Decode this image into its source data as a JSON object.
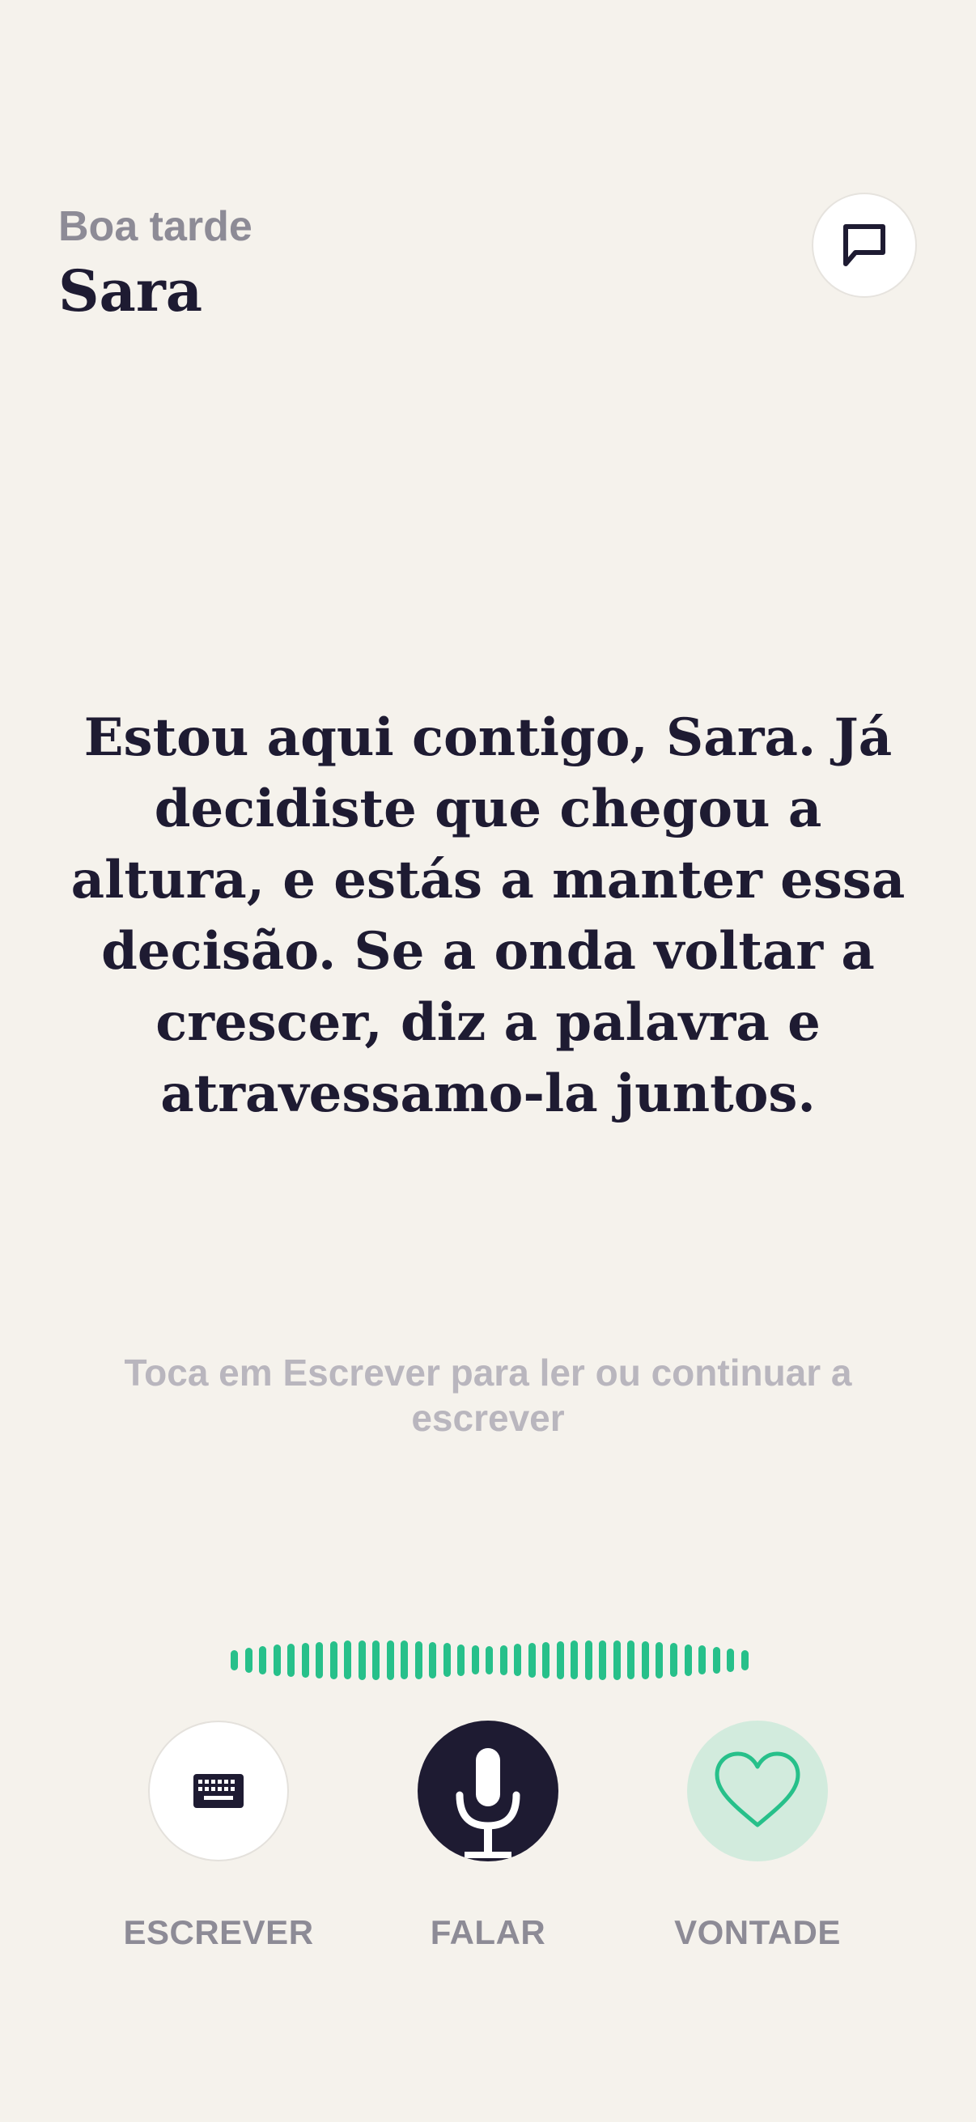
{
  "header": {
    "greeting": "Boa tarde",
    "user_name": "Sara",
    "chat_icon": "chat-bubble-icon"
  },
  "main": {
    "message": "Estou aqui contigo, Sara. Já decidiste que chegou a altura, e estás a manter essa decisão. Se a onda voltar a crescer, diz a palavra e atravessamo-la juntos.",
    "hint": "Toca em Escrever para ler ou continuar a escrever"
  },
  "waveform": {
    "color": "#27c08a",
    "levels": [
      0.5,
      0.62,
      0.7,
      0.78,
      0.82,
      0.86,
      0.9,
      0.94,
      0.96,
      0.98,
      0.98,
      0.98,
      0.96,
      0.94,
      0.9,
      0.84,
      0.78,
      0.72,
      0.7,
      0.74,
      0.8,
      0.86,
      0.9,
      0.94,
      0.96,
      0.98,
      0.98,
      0.98,
      0.96,
      0.94,
      0.9,
      0.84,
      0.78,
      0.72,
      0.66,
      0.58,
      0.5
    ]
  },
  "actions": {
    "write": {
      "label": "ESCREVER",
      "icon": "keyboard-icon"
    },
    "speak": {
      "label": "FALAR",
      "icon": "microphone-icon"
    },
    "desire": {
      "label": "VONTADE",
      "icon": "heart-icon"
    }
  },
  "colors": {
    "background": "#f5f2ec",
    "primary_text": "#1e1b32",
    "muted_text": "#8d8b96",
    "accent_green": "#27c08a",
    "dark_button": "#1e1b32",
    "light_green": "#d2ebdd"
  }
}
